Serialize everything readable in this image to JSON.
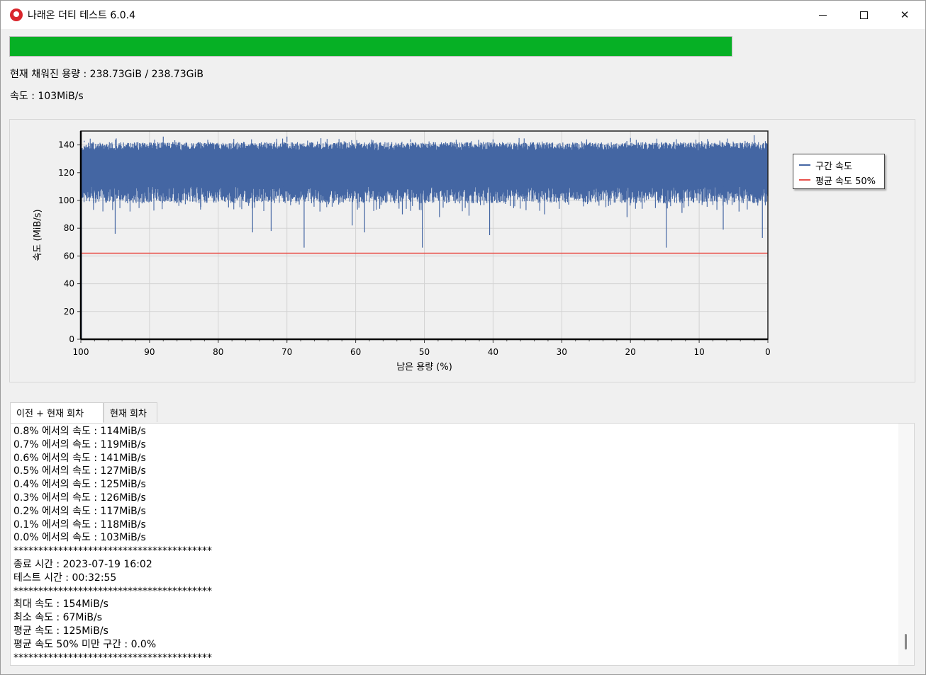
{
  "window": {
    "title": "나래온 더티 테스트 6.0.4",
    "minimize_label": "",
    "maximize_label": "",
    "close_label": "✕"
  },
  "progress": {
    "fraction": 1.0,
    "color": "#06b025"
  },
  "status": {
    "capacity": "현재 채워진 용량 : 238.73GiB / 238.73GiB",
    "speed": "속도 : 103MiB/s"
  },
  "chart_data": {
    "type": "line",
    "title": "",
    "xlabel": "남은 용량 (%)",
    "ylabel": "속도 (MiB/s)",
    "xlim": [
      100,
      0
    ],
    "ylim": [
      0,
      150
    ],
    "x_ticks": [
      "100",
      "90",
      "80",
      "70",
      "60",
      "50",
      "40",
      "30",
      "20",
      "10",
      "0"
    ],
    "y_ticks": [
      "0",
      "20",
      "40",
      "60",
      "80",
      "100",
      "120",
      "140"
    ],
    "grid": true,
    "legend_position": "right",
    "series": [
      {
        "name": "구간 속도",
        "color": "#4466a3",
        "band": {
          "low": 110,
          "high": 142
        },
        "dips": [
          [
            98.5,
            105
          ],
          [
            95,
            76
          ],
          [
            93.2,
            98
          ],
          [
            89,
            100
          ],
          [
            85.5,
            99
          ],
          [
            78.5,
            95
          ],
          [
            75,
            77
          ],
          [
            72.3,
            78
          ],
          [
            70.5,
            99
          ],
          [
            67.5,
            66
          ],
          [
            65.2,
            92
          ],
          [
            62,
            99
          ],
          [
            60.5,
            82
          ],
          [
            58.7,
            77
          ],
          [
            56.5,
            94
          ],
          [
            53.2,
            90
          ],
          [
            50.3,
            66
          ],
          [
            47.8,
            88
          ],
          [
            45.5,
            98
          ],
          [
            43.5,
            89
          ],
          [
            40.5,
            75
          ],
          [
            37.5,
            96
          ],
          [
            35.2,
            93
          ],
          [
            32.5,
            90
          ],
          [
            29,
            97
          ],
          [
            26.5,
            99
          ],
          [
            23.2,
            96
          ],
          [
            20.5,
            88
          ],
          [
            18.3,
            94
          ],
          [
            14.8,
            66
          ],
          [
            12.5,
            91
          ],
          [
            10,
            98
          ],
          [
            6.5,
            79
          ],
          [
            4.2,
            92
          ],
          [
            0.8,
            73
          ]
        ],
        "top": [
          [
            99.5,
            143
          ],
          [
            88,
            146
          ],
          [
            70,
            146
          ],
          [
            52,
            144
          ],
          [
            40,
            144
          ],
          [
            20,
            145
          ],
          [
            2,
            147
          ]
        ]
      },
      {
        "name": "평균 속도 50%",
        "color": "#e8504a",
        "x": [
          100,
          0
        ],
        "values": [
          62,
          62
        ]
      }
    ]
  },
  "tabs": [
    {
      "label": "이전 + 현재 회차"
    },
    {
      "label": "현재 회차"
    }
  ],
  "log": [
    "0.8% 에서의 속도 : 114MiB/s",
    "0.7% 에서의 속도 : 119MiB/s",
    "0.6% 에서의 속도 : 141MiB/s",
    "0.5% 에서의 속도 : 127MiB/s",
    "0.4% 에서의 속도 : 125MiB/s",
    "0.3% 에서의 속도 : 126MiB/s",
    "0.2% 에서의 속도 : 117MiB/s",
    "0.1% 에서의 속도 : 118MiB/s",
    "0.0% 에서의 속도 : 103MiB/s",
    "****************************************",
    "종료 시간 : 2023-07-19 16:02",
    "테스트 시간 : 00:32:55",
    "****************************************",
    "최대 속도 : 154MiB/s",
    "최소 속도 : 67MiB/s",
    "평균 속도 : 125MiB/s",
    "평균 속도 50% 미만 구간 : 0.0%",
    "****************************************"
  ]
}
